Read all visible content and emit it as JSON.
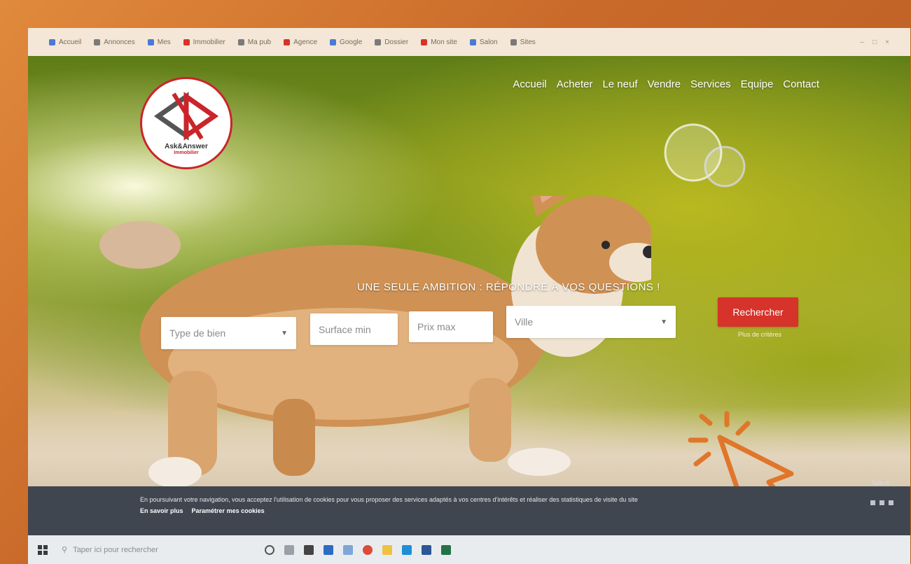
{
  "browser": {
    "bookmarks": [
      "Accueil",
      "Annonces",
      "Mes",
      "Immobilier",
      "Ma pub",
      "Agence",
      "Google",
      "Dossier",
      "Mon site",
      "Salon",
      "Sites"
    ]
  },
  "site": {
    "logo": {
      "name": "Ask&Answer",
      "subtitle": "Immobilier"
    },
    "nav": [
      "Accueil",
      "Acheter",
      "Le neuf",
      "Vendre",
      "Services",
      "Equipe",
      "Contact"
    ],
    "tagline": "UNE SEULE AMBITION : RÉPONDRE À VOS QUESTIONS !",
    "search": {
      "type_placeholder": "Type de bien",
      "surface_placeholder": "Surface min",
      "price_placeholder": "Prix max",
      "city_placeholder": "Ville",
      "button_label": "Rechercher",
      "more_criteria": "Plus de critères"
    },
    "page_tag": "Taille B"
  },
  "cookie_banner": {
    "text": "En poursuivant votre navigation, vous acceptez l'utilisation de cookies pour vous proposer des services adaptés à vos centres d'intérêts et réaliser des statistiques de visite du site",
    "learn_more": "En savoir plus",
    "settings": "Paramétrer mes cookies"
  },
  "taskbar": {
    "search_placeholder": "Taper ici pour rechercher"
  },
  "colors": {
    "brand_red": "#d6332a",
    "cursor_orange": "#e0762a",
    "cookie_bg": "#3f4650"
  }
}
